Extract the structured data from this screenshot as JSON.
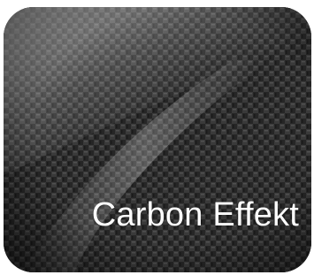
{
  "tile": {
    "label": "Carbon Effekt",
    "label_color": "#ffffff",
    "base_color": "#2a2a2a",
    "weave_dark": "#1c1c1c",
    "weave_light": "#4a4a4a"
  }
}
